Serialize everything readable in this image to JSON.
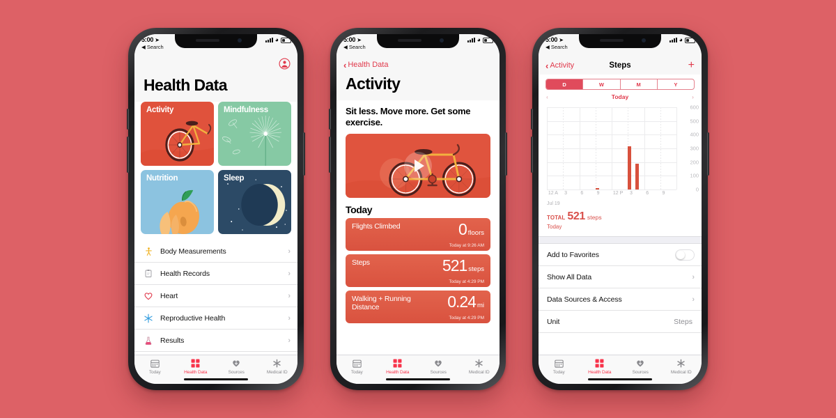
{
  "background_color": "#dd6166",
  "accent_red": "#e0394b",
  "status_bar": {
    "time": "5:00",
    "location_glyph": "➤",
    "back_label": "◀ Search"
  },
  "tabbar": {
    "items": [
      {
        "label": "Today",
        "icon": "calendar-icon",
        "active": false
      },
      {
        "label": "Health Data",
        "icon": "grid-squares-icon",
        "active": true
      },
      {
        "label": "Sources",
        "icon": "heart-download-icon",
        "active": false
      },
      {
        "label": "Medical ID",
        "icon": "asterisk-icon",
        "active": false
      }
    ]
  },
  "phone1": {
    "title": "Health Data",
    "avatar_icon": "profile-avatar-icon",
    "tiles": [
      {
        "label": "Activity",
        "art": "bicycle-illustration",
        "color": "#e0523c"
      },
      {
        "label": "Mindfulness",
        "art": "dandelion-illustration",
        "color": "#86c9a4"
      },
      {
        "label": "Nutrition",
        "art": "peach-illustration",
        "color": "#8cc3e0"
      },
      {
        "label": "Sleep",
        "art": "moon-stars-illustration",
        "color": "#2c4a66"
      }
    ],
    "list": [
      {
        "label": "Body Measurements",
        "icon": "walking-person-icon"
      },
      {
        "label": "Health Records",
        "icon": "clipboard-icon"
      },
      {
        "label": "Heart",
        "icon": "heart-outline-icon"
      },
      {
        "label": "Reproductive Health",
        "icon": "snowflake-icon"
      },
      {
        "label": "Results",
        "icon": "flask-icon"
      }
    ],
    "disclosure": "›"
  },
  "phone2": {
    "back_label": "Health Data",
    "title": "Activity",
    "subtitle": "Sit less. Move more. Get some exercise.",
    "video_art": "bicycle-illustration",
    "play_icon": "play-icon",
    "today_header": "Today",
    "metrics": [
      {
        "name": "Flights Climbed",
        "value": "0",
        "unit": "floors",
        "time": "Today at 9:26 AM"
      },
      {
        "name": "Steps",
        "value": "521",
        "unit": "steps",
        "time": "Today at 4:29 PM"
      },
      {
        "name": "Walking + Running Distance",
        "value": "0.24",
        "unit": "mi",
        "time": "Today at 4:29 PM"
      }
    ]
  },
  "phone3": {
    "back_label": "Activity",
    "title": "Steps",
    "add_icon": "plus-icon",
    "segments": [
      {
        "label": "D",
        "selected": true
      },
      {
        "label": "W",
        "selected": false
      },
      {
        "label": "M",
        "selected": false
      },
      {
        "label": "Y",
        "selected": false
      }
    ],
    "date_nav": {
      "prev_icon": "chevron-left-icon",
      "label": "Today",
      "next_icon": "chevron-right-icon"
    },
    "total": {
      "prefix": "TOTAL",
      "value": "521",
      "unit": "steps",
      "sub": "Today"
    },
    "settings": [
      {
        "label": "Add to Favorites",
        "control": "toggle",
        "value": "off"
      },
      {
        "label": "Show All Data",
        "control": "disclosure",
        "value": "›"
      },
      {
        "label": "Data Sources & Access",
        "control": "disclosure",
        "value": "›"
      },
      {
        "label": "Unit",
        "control": "value",
        "value": "Steps"
      }
    ]
  },
  "chart_data": {
    "type": "bar",
    "title": "Steps",
    "xlabel": "",
    "ylabel": "steps",
    "date_label": "Jul 19",
    "ylim": [
      0,
      600
    ],
    "yticks": [
      0,
      100,
      200,
      300,
      400,
      500,
      600
    ],
    "xticks": [
      "12 A",
      "3",
      "6",
      "9",
      "12 P",
      "3",
      "6",
      "9"
    ],
    "grid": true,
    "legend": "none",
    "x": [
      "9:26 AM",
      "3:05 PM",
      "3:35 PM"
    ],
    "values": [
      12,
      315,
      190
    ],
    "total": 521,
    "unit": "steps"
  }
}
